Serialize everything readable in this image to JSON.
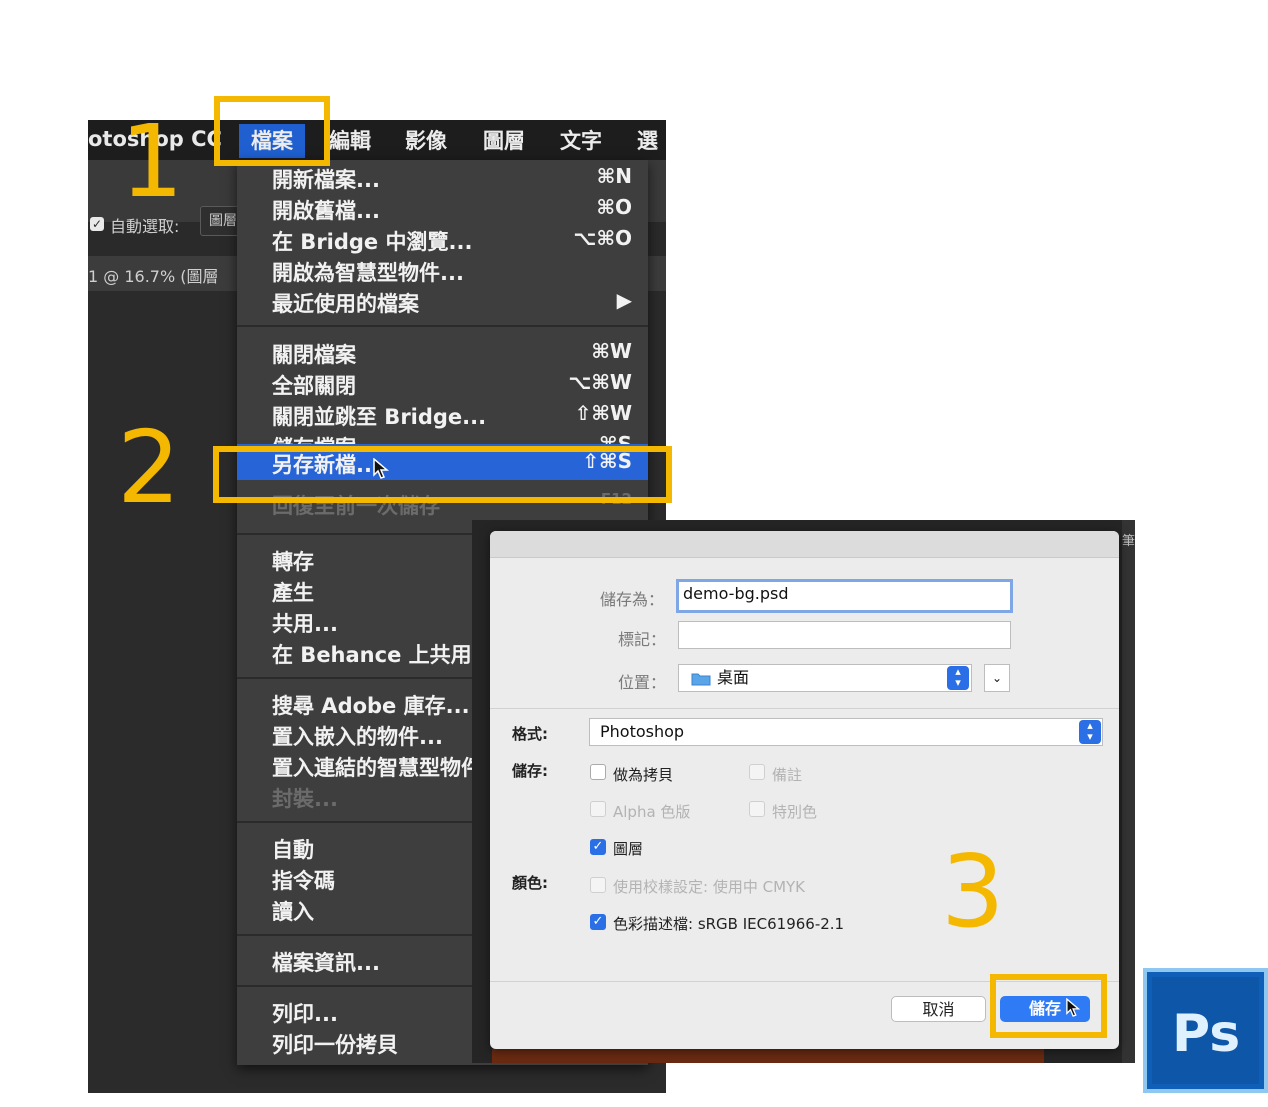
{
  "menubar": {
    "app_name": "otoshop CC",
    "items": [
      "檔案",
      "編輯",
      "影像",
      "圖層",
      "文字",
      "選"
    ]
  },
  "options_bar": {
    "auto_select": "自動選取:",
    "layer_field": "圖層"
  },
  "doc_tab": {
    "title": "1 @ 16.7% (圖層"
  },
  "file_menu": {
    "items": [
      {
        "label": "開新檔案...",
        "shortcut": "⌘N"
      },
      {
        "label": "開啟舊檔...",
        "shortcut": "⌘O"
      },
      {
        "label": "在 Bridge 中瀏覽...",
        "shortcut": "⌥⌘O"
      },
      {
        "label": "開啟為智慧型物件...",
        "shortcut": ""
      },
      {
        "label": "最近使用的檔案",
        "shortcut": "▶"
      },
      {
        "label": "關閉檔案",
        "shortcut": "⌘W"
      },
      {
        "label": "全部關閉",
        "shortcut": "⌥⌘W"
      },
      {
        "label": "關閉並跳至 Bridge...",
        "shortcut": "⇧⌘W"
      },
      {
        "label": "儲存檔案",
        "shortcut": "⌘S"
      },
      {
        "label": "另存新檔...",
        "shortcut": "⇧⌘S"
      },
      {
        "label": "回復至前一次儲存",
        "shortcut": "F12"
      },
      {
        "label": "轉存",
        "shortcut": ""
      },
      {
        "label": "產生",
        "shortcut": ""
      },
      {
        "label": "共用...",
        "shortcut": ""
      },
      {
        "label": "在 Behance 上共用...",
        "shortcut": ""
      },
      {
        "label": "搜尋 Adobe 庫存...",
        "shortcut": ""
      },
      {
        "label": "置入嵌入的物件...",
        "shortcut": ""
      },
      {
        "label": "置入連結的智慧型物件...",
        "shortcut": ""
      },
      {
        "label": "封裝...",
        "shortcut": ""
      },
      {
        "label": "自動",
        "shortcut": ""
      },
      {
        "label": "指令碼",
        "shortcut": ""
      },
      {
        "label": "讀入",
        "shortcut": ""
      },
      {
        "label": "檔案資訊...",
        "shortcut": ""
      },
      {
        "label": "列印...",
        "shortcut": ""
      },
      {
        "label": "列印一份拷貝",
        "shortcut": ""
      }
    ]
  },
  "save_dialog": {
    "save_as_label": "儲存為：",
    "save_as_value": "demo-bg.psd",
    "tags_label": "標記：",
    "tags_value": "",
    "where_label": "位置：",
    "where_value": "桌面",
    "format_label": "格式:",
    "format_value": "Photoshop",
    "save_label": "儲存:",
    "options": {
      "as_copy": "做為拷貝",
      "notes": "備註",
      "alpha": "Alpha 色版",
      "spot": "特別色",
      "layers": "圖層"
    },
    "color_label": "顏色:",
    "use_proof": "使用校樣設定: 使用中 CMYK",
    "icc_profile": "色彩描述檔: sRGB IEC61966-2.1",
    "cancel_button": "取消",
    "save_button": "儲存"
  },
  "annotations": {
    "step1": "1",
    "step2": "2",
    "step3": "3"
  },
  "logo": {
    "text": "Ps"
  },
  "right_edge_text": "筆",
  "colors": {
    "highlight": "#f5b800",
    "menu_selected": "#2664d8",
    "dialog_button": "#2f7bf5"
  }
}
